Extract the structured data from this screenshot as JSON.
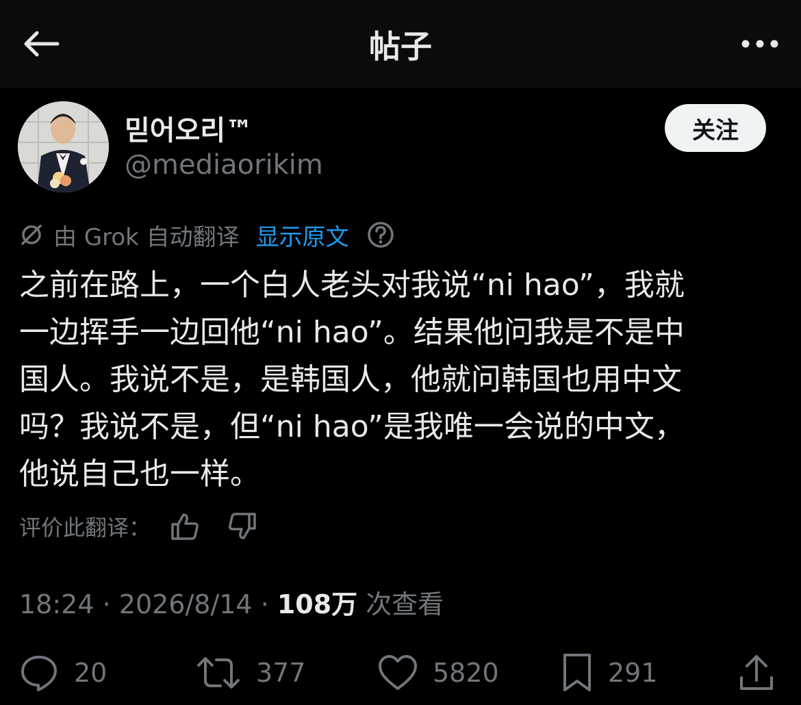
{
  "header": {
    "title": "帖子"
  },
  "author": {
    "display_name": "믿어오리™",
    "handle": "@mediaorikim",
    "follow_label": "关注"
  },
  "translation": {
    "notice": "由 Grok 自动翻译",
    "show_original_label": "显示原文"
  },
  "post": {
    "text_lines": [
      "之前在路上，一个白人老头对我说“ni hao”，我就",
      "一边挥手一边回他“ni hao”。结果他问我是不是中",
      "国人。我说不是，是韩国人，他就问韩国也用中文",
      "吗？我说不是，但“ni hao”是我唯一会说的中文，",
      "他说自己也一样。"
    ]
  },
  "rate_translation": {
    "label": "评价此翻译："
  },
  "meta": {
    "time": "18:24",
    "date": "2026/8/14",
    "views_count": "108万",
    "views_label": "次查看"
  },
  "actions": {
    "replies": "20",
    "reposts": "377",
    "likes": "5820",
    "bookmarks": "291"
  },
  "colors": {
    "background": "#000000",
    "text": "#e7e9ea",
    "muted": "#71767b",
    "link": "#1d9bf0",
    "follow_bg": "#eff3f4"
  }
}
